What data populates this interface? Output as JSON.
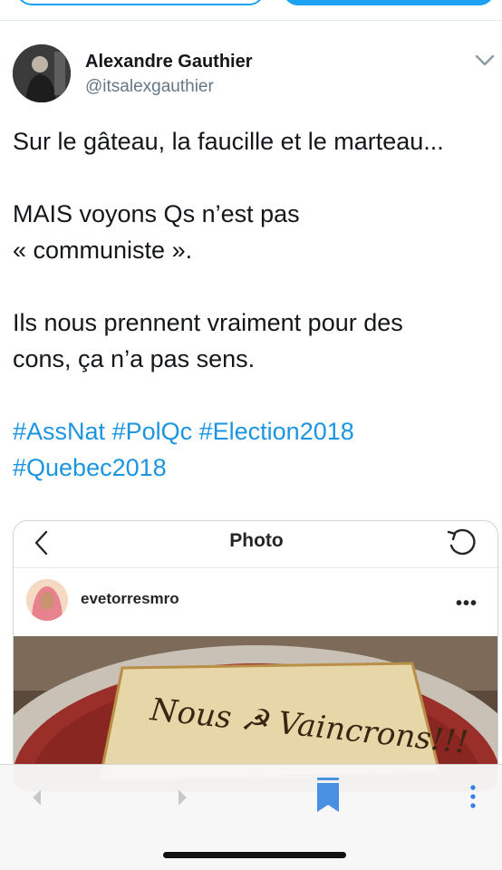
{
  "tweet": {
    "author": {
      "display_name": "Alexandre Gauthier",
      "handle": "@itsalexgauthier"
    },
    "text_lines": [
      "Sur le gâteau, la faucille et le marteau...",
      "",
      "MAIS voyons Qs n’est pas",
      "« communiste ».",
      "",
      "Ils nous prennent vraiment pour des",
      "cons, ça n’a pas sens.",
      ""
    ],
    "hashtags_line1": [
      "#AssNat",
      "#PolQc",
      "#Election2018"
    ],
    "hashtags_line2": [
      "#Quebec2018"
    ],
    "icons": {
      "options": "chevron-down-icon"
    }
  },
  "embedded_card": {
    "title": "Photo",
    "instagram_user": "evetorresmro",
    "more_label": "•••",
    "photo_text": "Nous ☭ Vaincrons!!!",
    "icons": {
      "back": "chevron-left-icon",
      "refresh": "refresh-icon",
      "more": "more-horizontal-icon"
    }
  },
  "toolbar": {
    "icons": {
      "back": "back-arrow-icon",
      "forward": "forward-arrow-icon",
      "bookmark": "bookmark-icon",
      "more": "more-vertical-icon"
    }
  },
  "colors": {
    "twitter_blue": "#1da1f2",
    "hashtag": "#1b95e0",
    "text": "#14171a",
    "secondary_text": "#657786",
    "toolbar_bg": "#f7f7f7"
  }
}
